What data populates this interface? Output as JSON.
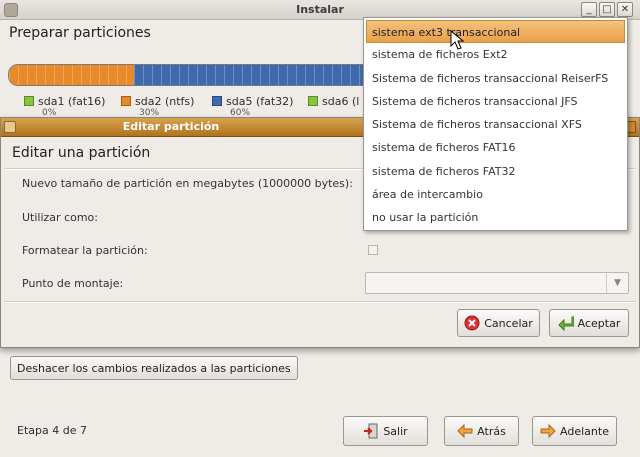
{
  "main_window": {
    "title": "Instalar",
    "section_title": "Preparar particiones",
    "partitions": [
      {
        "name": "sda1 (fat16)",
        "percent": "0%",
        "color": "#8ac43f",
        "share": 0
      },
      {
        "name": "sda2 (ntfs)",
        "percent": "30%",
        "color": "#e88a2a",
        "share": 30
      },
      {
        "name": "sda5 (fat32)",
        "percent": "60%",
        "color": "#3f6aad",
        "share": 60
      },
      {
        "name": "sda6 (l",
        "percent": "",
        "color": "#8ac43f",
        "share": 10
      }
    ],
    "undo_button": "Deshacer los cambios realizados a las particiones",
    "step": "Etapa 4 de 7",
    "buttons": {
      "quit": "Salir",
      "back": "Atrás",
      "forward": "Adelante"
    }
  },
  "dialog": {
    "title": "Editar partición",
    "heading": "Editar una partición",
    "labels": {
      "size": "Nuevo tamaño de partición en megabytes (1000000 bytes):",
      "use_as": "Utilizar como:",
      "format": "Formatear la partición:",
      "mount": "Punto de montaje:"
    },
    "buttons": {
      "cancel": "Cancelar",
      "accept": "Aceptar"
    }
  },
  "dropdown": {
    "items": [
      "sistema ext3 transaccional",
      "sistema de ficheros Ext2",
      "Sistema de ficheros transaccional ReiserFS",
      "Sistema de ficheros transaccional JFS",
      "Sistema de ficheros transaccional XFS",
      "sistema de ficheros FAT16",
      "sistema de ficheros FAT32",
      "área de intercambio",
      "no usar la partición"
    ],
    "selected_index": 0
  }
}
